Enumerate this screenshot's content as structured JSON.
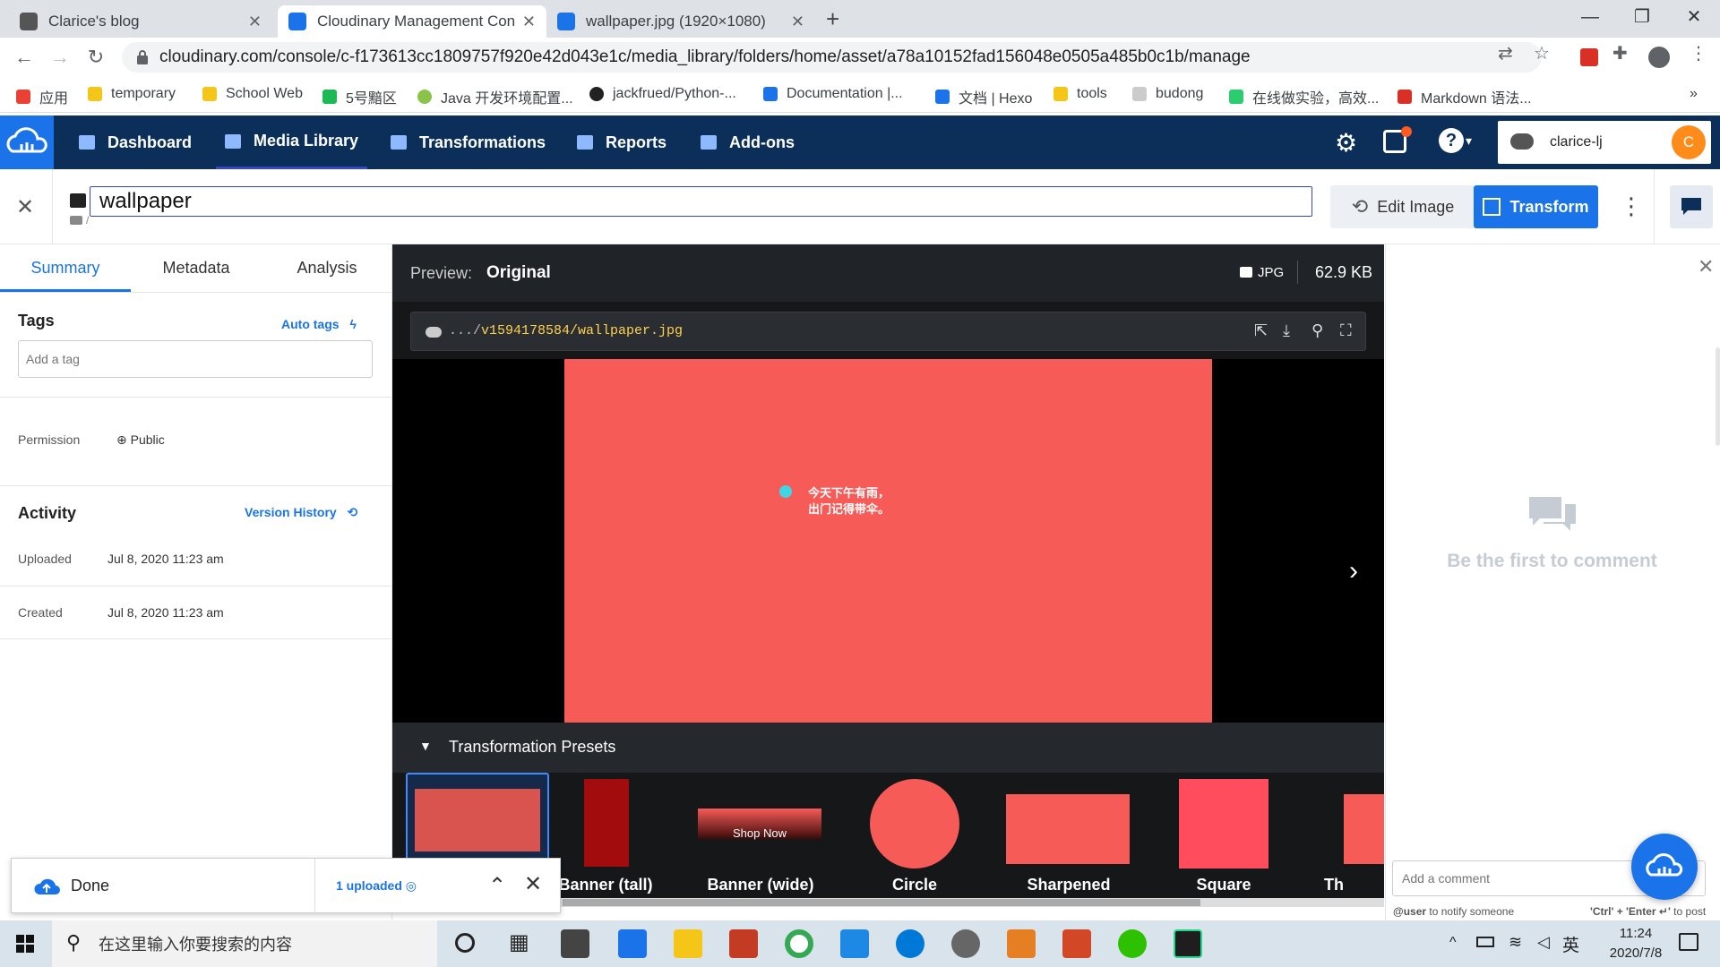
{
  "browser": {
    "tabs": [
      {
        "title": "Clarice's blog",
        "active": false
      },
      {
        "title": "Cloudinary Management Cons",
        "active": true
      },
      {
        "title": "wallpaper.jpg (1920×1080)",
        "active": false
      }
    ],
    "new_tab": "+",
    "url": "cloudinary.com/console/c-f173613cc1809757f920e42d043e1c/media_library/folders/home/asset/a78a10152fad156048e0505a485b0c1b/manage",
    "bookmarks": [
      "应用",
      "temporary",
      "School Web",
      "5号黯区",
      "Java 开发环境配置...",
      "jackfrued/Python-...",
      "Documentation |...",
      "文档 | Hexo",
      "tools",
      "budong",
      "在线做实验，高效...",
      "Markdown 语法..."
    ],
    "more_bookmarks": "»"
  },
  "nav": {
    "items": [
      "Dashboard",
      "Media Library",
      "Transformations",
      "Reports",
      "Add-ons"
    ],
    "user": "clarice-lj",
    "avatar_letter": "C"
  },
  "asset": {
    "title": "wallpaper",
    "breadcrumb": "/",
    "edit_label": "Edit Image",
    "transform_label": "Transform"
  },
  "left": {
    "tabs": [
      "Summary",
      "Metadata",
      "Analysis"
    ],
    "tags_title": "Tags",
    "auto_tags": "Auto tags",
    "tag_placeholder": "Add a tag",
    "permission_label": "Permission",
    "permission_value": "Public",
    "activity_title": "Activity",
    "version_history": "Version History",
    "uploaded_label": "Uploaded",
    "uploaded_value": "Jul 8, 2020 11:23 am",
    "created_label": "Created",
    "created_value": "Jul 8, 2020 11:23 am"
  },
  "preview": {
    "label": "Preview:",
    "mode": "Original",
    "format": "JPG",
    "size": "62.9 KB",
    "url_prefix": ".../",
    "url_path": "v1594178584/wallpaper.jpg",
    "image_text_line1": "今天下午有雨，",
    "image_text_line2": "出门记得带伞。",
    "presets_title": "Transformation Presets",
    "presets": [
      {
        "label": ""
      },
      {
        "label": "Banner (tall)"
      },
      {
        "label": "Banner (wide)"
      },
      {
        "label": "Circle"
      },
      {
        "label": "Sharpened"
      },
      {
        "label": "Square"
      },
      {
        "label": "Th"
      }
    ],
    "shop_now": "Shop Now"
  },
  "comments": {
    "empty_text": "Be the first to comment",
    "placeholder": "Add a comment",
    "hint_left": "@user",
    "hint_left_rest": "to notify someone",
    "hint_right": "'Ctrl' + 'Enter ↵'",
    "hint_right_rest": "to post"
  },
  "toast": {
    "status": "Done",
    "count": "1 uploaded"
  },
  "taskbar": {
    "search_placeholder": "在这里输入你要搜索的内容",
    "ime": "英",
    "time": "11:24",
    "date": "2020/7/8"
  },
  "colors": {
    "cloudinary_nav": "#0c2f5a",
    "accent_blue": "#1a73e8",
    "wallpaper": "#f65b57",
    "teal_dot": "#3fd5e6"
  }
}
